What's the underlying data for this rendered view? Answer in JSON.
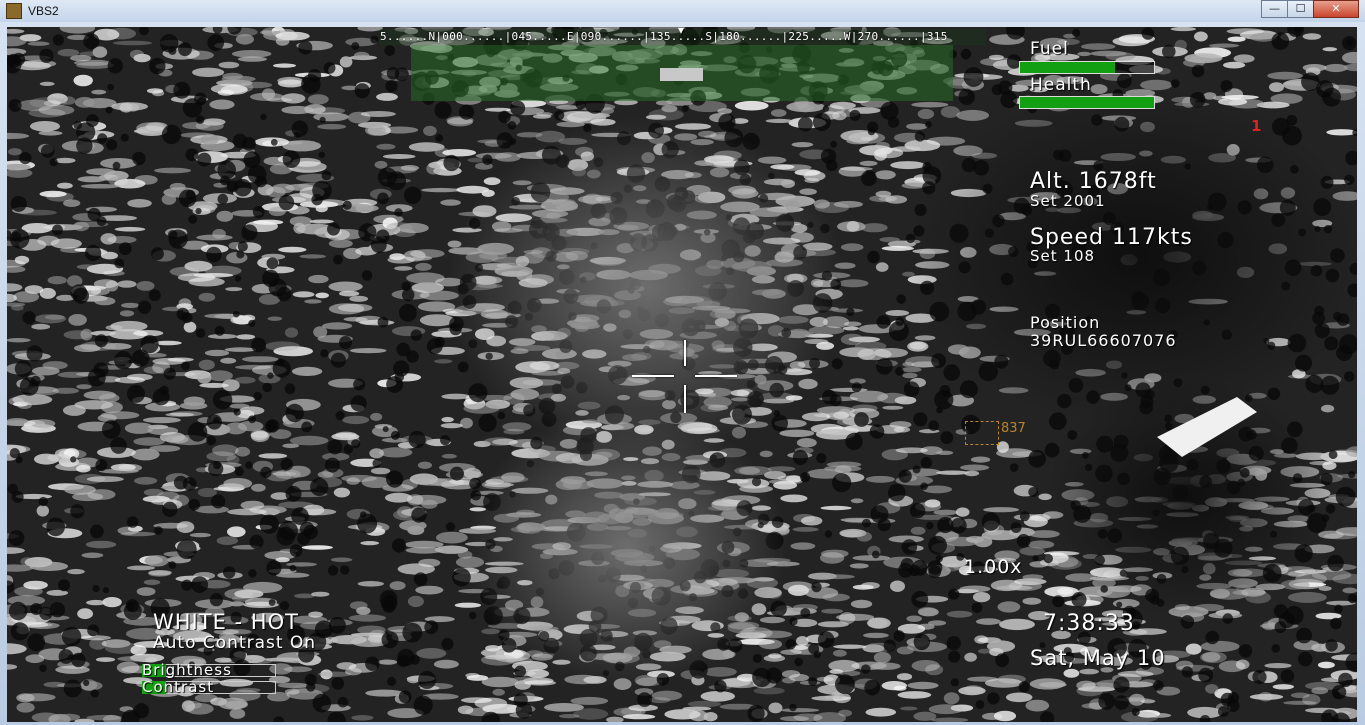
{
  "window": {
    "title": "VBS2",
    "controls": {
      "minimize": "—",
      "maximize": "☐",
      "close": "✕"
    }
  },
  "compass": {
    "scale_text": "5......N|000......|045.....E|090......|135.....S|180......|225.....W|270......|315",
    "heading_marker": "▾"
  },
  "status": {
    "fuel_label": "Fuel",
    "fuel_level": 0.71,
    "health_label": "Health",
    "health_level": 1.0,
    "waypoint_number": "1"
  },
  "flight": {
    "altitude": "Alt. 1678ft",
    "altitude_set": "Set  2001",
    "speed": "Speed 117kts",
    "speed_set": "Set  108",
    "position_label": "Position",
    "position_value": "39RUL66607076"
  },
  "target": {
    "label": "837"
  },
  "camera": {
    "zoom": "1.00x",
    "mode": "WHITE - HOT",
    "contrast_mode": "Auto Contrast On",
    "brightness_label": "Brightness",
    "brightness_level": 0.18,
    "contrast_label": "Contrast",
    "contrast_level": 0.18
  },
  "clock": {
    "time": "7:38:33",
    "date": "Sat, May 10"
  },
  "colors": {
    "hud_green": "#12a012",
    "waypoint_red": "#dd2222",
    "target_amber": "#b8862a"
  }
}
